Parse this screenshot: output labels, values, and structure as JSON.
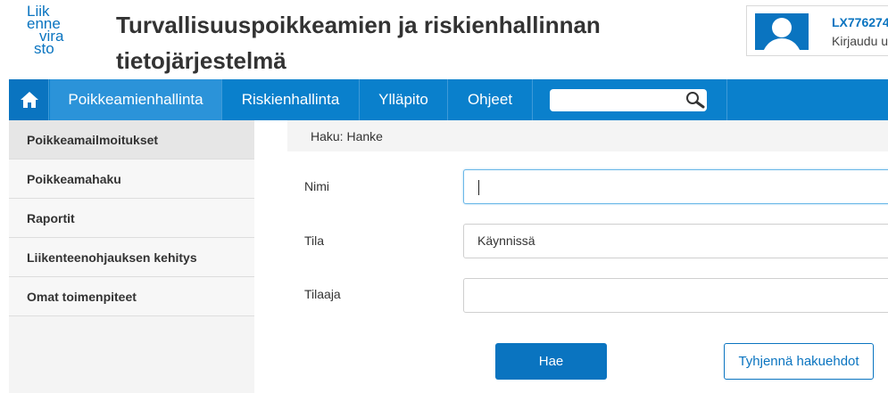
{
  "brand": {
    "logo_lines": [
      "Liik",
      "enne",
      "vira",
      "sto"
    ],
    "title_line1": "Turvallisuuspoikkeamien ja riskienhallinnan",
    "title_line2": "tietojärjestelmä",
    "accent_color": "#0a74c0"
  },
  "user": {
    "id": "LX776274",
    "login_text": "Kirjaudu ulos",
    "icon": "user-avatar-icon"
  },
  "nav": {
    "home_icon": "home-icon",
    "items": [
      {
        "label": "Poikkeamienhallinta",
        "active": true
      },
      {
        "label": "Riskienhallinta",
        "active": false
      },
      {
        "label": "Ylläpito",
        "active": false
      },
      {
        "label": "Ohjeet",
        "active": false
      }
    ],
    "search": {
      "value": "",
      "icon": "search-icon"
    }
  },
  "sidebar": {
    "items": [
      {
        "label": "Poikkeamailmoitukset",
        "active": true
      },
      {
        "label": "Poikkeamahaku",
        "active": false
      },
      {
        "label": "Raportit",
        "active": false
      },
      {
        "label": "Liikenteenohjauksen kehitys",
        "active": false
      },
      {
        "label": "Omat toimenpiteet",
        "active": false
      }
    ]
  },
  "main": {
    "breadcrumb": "Haku: Hanke",
    "form": {
      "name_label": "Nimi",
      "name_value": "",
      "status_label": "Tila",
      "status_value": "Käynnissä",
      "client_label": "Tilaaja",
      "client_value": ""
    },
    "search_button": "Hae",
    "clear_button": "Tyhjennä hakuehdot"
  }
}
